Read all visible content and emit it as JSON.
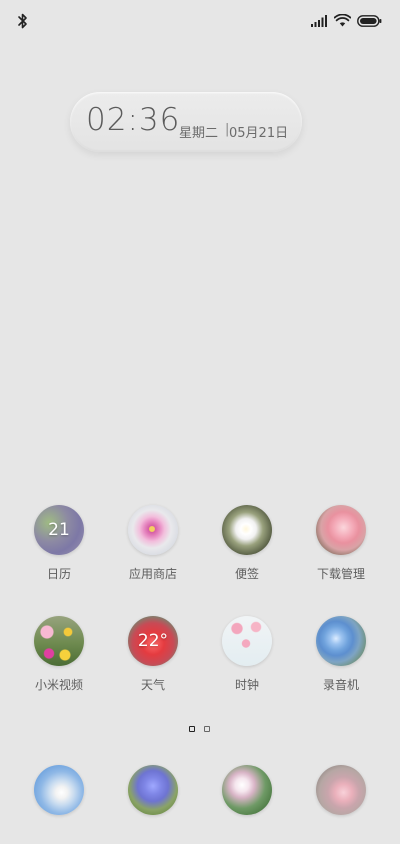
{
  "status_bar": {
    "left_icon": "bluetooth-icon",
    "right_icons": [
      "signal-icon",
      "wifi-icon",
      "battery-icon"
    ]
  },
  "clock": {
    "time": "02:36",
    "weekday": "星期二",
    "separator": "|",
    "date": "05月21日"
  },
  "apps_row1": [
    {
      "label": "日历",
      "badge": "21",
      "icon": "calendar-icon"
    },
    {
      "label": "应用商店",
      "badge": "",
      "icon": "app-store-icon"
    },
    {
      "label": "便签",
      "badge": "",
      "icon": "notes-icon"
    },
    {
      "label": "下载管理",
      "badge": "",
      "icon": "downloads-icon"
    }
  ],
  "apps_row2": [
    {
      "label": "小米视频",
      "badge": "",
      "icon": "video-icon"
    },
    {
      "label": "天气",
      "badge": "22°",
      "icon": "weather-icon"
    },
    {
      "label": "时钟",
      "badge": "",
      "icon": "clock-icon"
    },
    {
      "label": "录音机",
      "badge": "",
      "icon": "recorder-icon"
    }
  ],
  "dock": [
    {
      "icon": "phone-icon"
    },
    {
      "icon": "messages-icon"
    },
    {
      "icon": "browser-icon"
    },
    {
      "icon": "camera-icon"
    }
  ],
  "page_indicator": {
    "pages": 2,
    "active_page": 1
  }
}
